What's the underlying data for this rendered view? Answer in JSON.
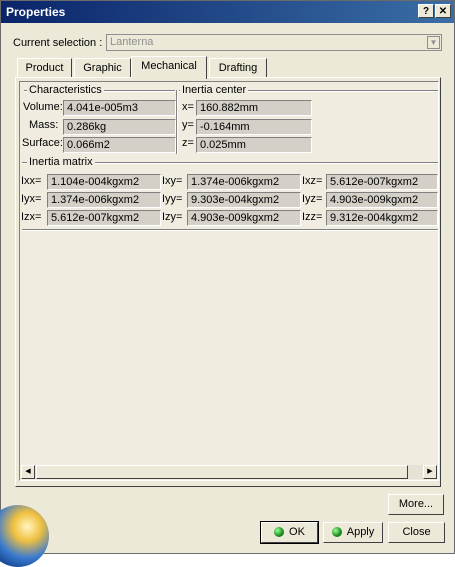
{
  "window": {
    "title": "Properties",
    "help_label": "?",
    "close_label": "✕"
  },
  "selection": {
    "label": "Current selection :",
    "value": "Lanterna"
  },
  "tabs": [
    {
      "label": "Product",
      "active": false
    },
    {
      "label": "Graphic",
      "active": false
    },
    {
      "label": "Mechanical",
      "active": true
    },
    {
      "label": "Drafting",
      "active": false
    }
  ],
  "characteristics": {
    "title": "Characteristics",
    "volume_label": "Volume:",
    "volume_value": "4.041e-005m3",
    "mass_label": "Mass:",
    "mass_value": "0.286kg",
    "surface_label": "Surface:",
    "surface_value": "0.066m2"
  },
  "inertia_center": {
    "title": "Inertia center",
    "x_label": "x=",
    "x_value": "160.882mm",
    "y_label": "y=",
    "y_value": "-0.164mm",
    "z_label": "z=",
    "z_value": "0.025mm"
  },
  "inertia_matrix": {
    "title": "Inertia matrix",
    "cells": [
      {
        "label": "Ixx=",
        "value": "1.104e-004kgxm2"
      },
      {
        "label": "Ixy=",
        "value": "1.374e-006kgxm2"
      },
      {
        "label": "Ixz=",
        "value": "5.612e-007kgxm2"
      },
      {
        "label": "Iyx=",
        "value": "1.374e-006kgxm2"
      },
      {
        "label": "Iyy=",
        "value": "9.303e-004kgxm2"
      },
      {
        "label": "Iyz=",
        "value": "4.903e-009kgxm2"
      },
      {
        "label": "Izx=",
        "value": "5.612e-007kgxm2"
      },
      {
        "label": "Izy=",
        "value": "4.903e-009kgxm2"
      },
      {
        "label": "Izz=",
        "value": "9.312e-004kgxm2"
      }
    ]
  },
  "buttons": {
    "more": "More...",
    "ok": "OK",
    "apply": "Apply",
    "close": "Close"
  },
  "icons": {
    "scroll_left": "scroll-left-arrow-icon",
    "scroll_right": "scroll-right-arrow-icon",
    "ok": "green-ball-icon",
    "apply": "green-ball-icon"
  }
}
